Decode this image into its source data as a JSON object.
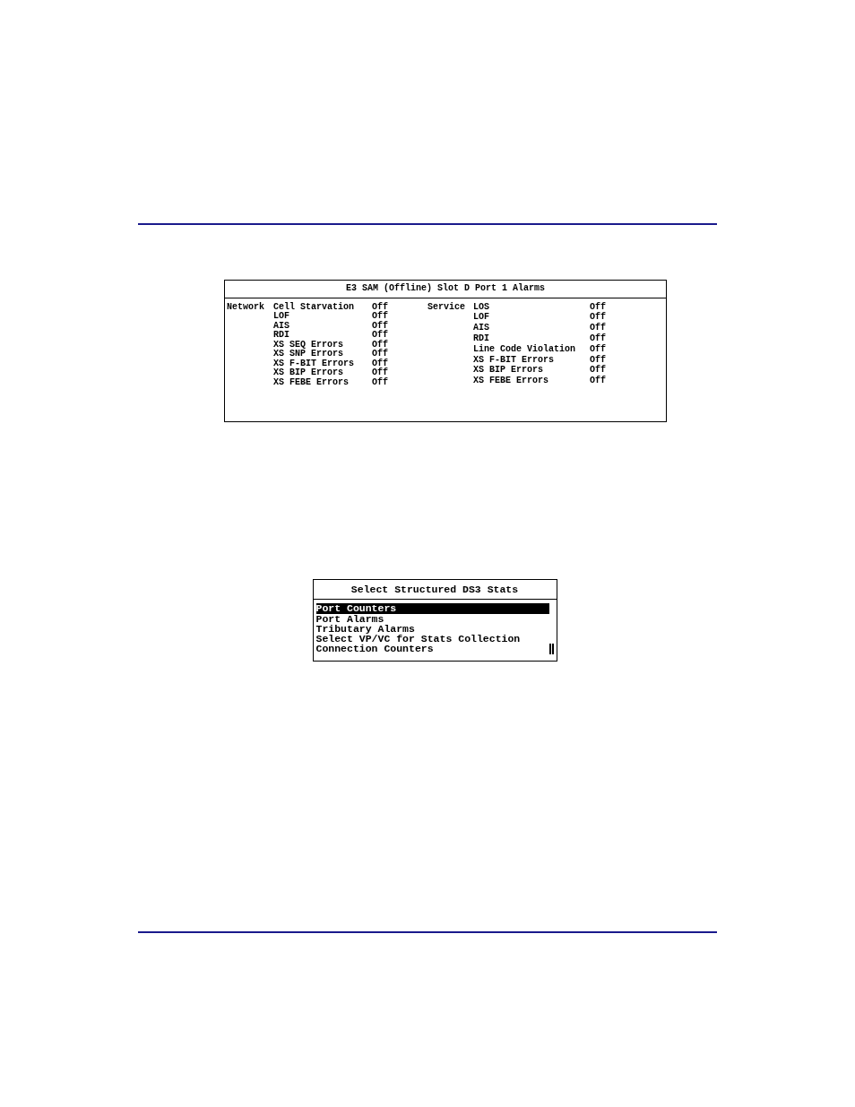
{
  "alarms_panel": {
    "title": "E3 SAM (Offline) Slot D Port 1 Alarms",
    "groups": [
      {
        "label": "Network",
        "items": [
          {
            "name": "Cell Starvation",
            "value": "Off"
          },
          {
            "name": "LOF",
            "value": "Off"
          },
          {
            "name": "AIS",
            "value": "Off"
          },
          {
            "name": "RDI",
            "value": "Off"
          },
          {
            "name": "XS SEQ Errors",
            "value": "Off"
          },
          {
            "name": "XS SNP Errors",
            "value": "Off"
          },
          {
            "name": "XS F-BIT Errors",
            "value": "Off"
          },
          {
            "name": "XS BIP Errors",
            "value": "Off"
          },
          {
            "name": "XS FEBE Errors",
            "value": "Off"
          }
        ]
      },
      {
        "label": "Service",
        "items": [
          {
            "name": "LOS",
            "value": "Off"
          },
          {
            "name": "LOF",
            "value": "Off"
          },
          {
            "name": "AIS",
            "value": "Off"
          },
          {
            "name": "RDI",
            "value": "Off"
          },
          {
            "name": "Line Code Violation",
            "value": "Off"
          },
          {
            "name": "XS F-BIT Errors",
            "value": "Off"
          },
          {
            "name": "XS BIP Errors",
            "value": "Off"
          },
          {
            "name": "XS FEBE Errors",
            "value": "Off"
          }
        ]
      }
    ]
  },
  "stats_menu": {
    "title": "Select Structured DS3 Stats",
    "items": [
      {
        "label": "Port Counters",
        "selected": true
      },
      {
        "label": "Port Alarms",
        "selected": false
      },
      {
        "label": "Tributary Alarms",
        "selected": false
      },
      {
        "label": "Select VP/VC for Stats Collection",
        "selected": false
      },
      {
        "label": "Connection Counters",
        "selected": false
      }
    ]
  }
}
